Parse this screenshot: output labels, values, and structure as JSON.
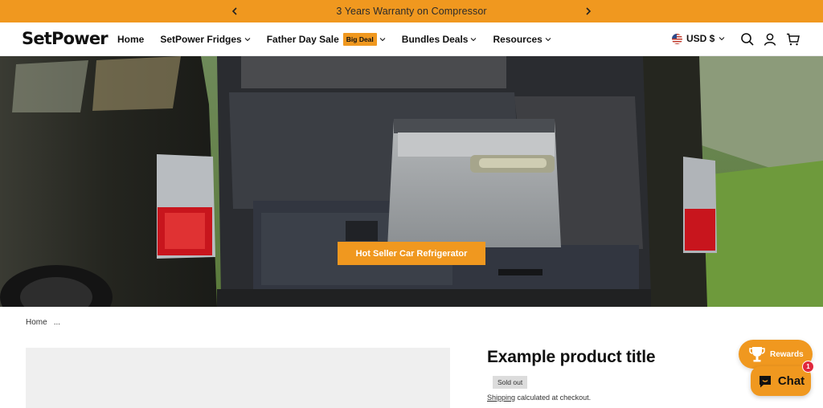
{
  "colors": {
    "accent": "#f0981f",
    "text": "#111111",
    "placeholder": "#efefef",
    "badge_red": "#e0283d"
  },
  "announcement": {
    "text": "3 Years Warranty on Compressor",
    "prev_icon": "chevron-left-icon",
    "next_icon": "chevron-right-icon"
  },
  "header": {
    "logo": "SetPower",
    "nav": [
      {
        "label": "Home"
      },
      {
        "label": "SetPower Fridges"
      },
      {
        "label": "Father Day Sale",
        "badge": "Big Deal"
      },
      {
        "label": "Bundles Deals"
      },
      {
        "label": "Resources"
      }
    ],
    "currency": "USD $",
    "icons": [
      "search-icon",
      "account-icon",
      "cart-icon"
    ]
  },
  "hero": {
    "button_label": "Hot Seller Car Refrigerator"
  },
  "breadcrumb": {
    "home": "Home",
    "current": "..."
  },
  "product": {
    "title": "Example product title",
    "status_badge": "Sold out",
    "shipping_link": "Shipping",
    "shipping_text": " calculated at checkout."
  },
  "floating": {
    "rewards_label": "Rewards",
    "chat_label": "Chat",
    "chat_badge_count": "1"
  }
}
